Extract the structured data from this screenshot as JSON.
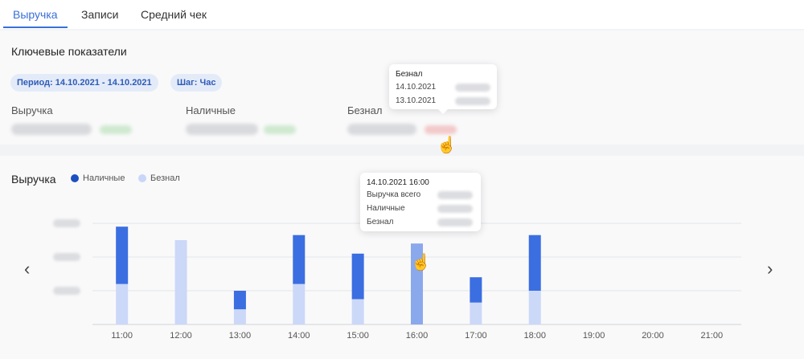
{
  "tabs": [
    {
      "label": "Выручка",
      "active": true
    },
    {
      "label": "Записи",
      "active": false
    },
    {
      "label": "Средний чек",
      "active": false
    }
  ],
  "key_metrics": {
    "title": "Ключевые показатели",
    "period_chip": "Период: 14.10.2021 - 14.10.2021",
    "step_chip": "Шаг: Час",
    "kpis": [
      {
        "label": "Выручка"
      },
      {
        "label": "Наличные"
      },
      {
        "label": "Безнал"
      }
    ]
  },
  "kpi_tooltip": {
    "title": "Безнал",
    "rows": [
      "14.10.2021",
      "13.10.2021"
    ]
  },
  "revenue_chart": {
    "title": "Выручка",
    "legend": [
      {
        "label": "Наличные",
        "color": "#1e4fc0"
      },
      {
        "label": "Безнал",
        "color": "#c8d6f8"
      }
    ]
  },
  "chart_tooltip": {
    "title": "14.10.2021 16:00",
    "rows": [
      "Выручка всего",
      "Наличные",
      "Безнал"
    ]
  },
  "chart_data": {
    "type": "bar",
    "stacked": true,
    "categories": [
      "11:00",
      "12:00",
      "13:00",
      "14:00",
      "15:00",
      "16:00",
      "17:00",
      "18:00",
      "19:00",
      "20:00",
      "21:00"
    ],
    "series": [
      {
        "name": "Безнал",
        "color": "#ccd8f8",
        "values": [
          1.2,
          2.5,
          0.45,
          1.2,
          0.75,
          2.4,
          0.65,
          1.0,
          0,
          0,
          0
        ]
      },
      {
        "name": "Наличные",
        "color": "#3b6ee0",
        "values": [
          1.7,
          0,
          0.55,
          1.45,
          1.35,
          0,
          0.75,
          1.65,
          0,
          0,
          0
        ]
      }
    ],
    "highlighted_category": "16:00",
    "ylim": [
      0,
      3
    ],
    "grid": true
  }
}
